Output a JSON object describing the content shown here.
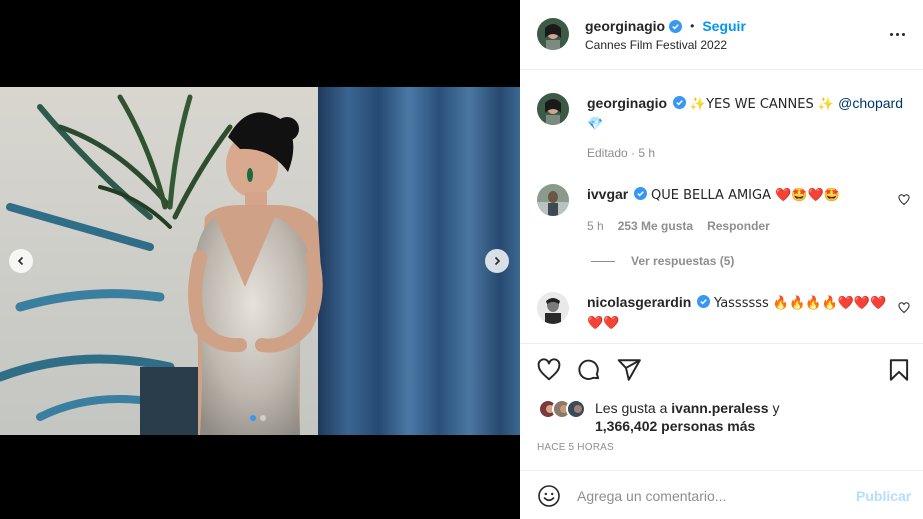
{
  "post": {
    "author": "georginagio",
    "follow_label": "Seguir",
    "bullet": "•",
    "location": "Cannes Film Festival 2022"
  },
  "caption": {
    "username": "georginagio",
    "text": "✨YES WE CANNES ✨ ",
    "mention": "@chopard",
    "emoji": "💎",
    "edited": "Editado · 5 h"
  },
  "comments": [
    {
      "username": "ivvgar",
      "text": "QUE BELLA AMIGA ❤️🤩❤️🤩",
      "time": "5 h",
      "likes": "253 Me gusta",
      "reply_label": "Responder",
      "view_replies": "Ver respuestas (5)"
    },
    {
      "username": "nicolasgerardin",
      "text": "Yassssss 🔥🔥🔥🔥❤️❤️❤️ ❤️❤️"
    }
  ],
  "likes": {
    "prefix": "Les gusta a ",
    "user": "ivann.peraless",
    "middle": " y",
    "count": "1,366,402 personas más"
  },
  "timestamp": "HACE 5 HORAS",
  "add_comment": {
    "placeholder": "Agrega un comentario...",
    "publish_label": "Publicar"
  },
  "carousel": {
    "slides": 2,
    "active": 1
  },
  "colors": {
    "accent": "#0095f6",
    "verified": "#3897f0",
    "publish_disabled": "#b2dffc",
    "muted": "#8e8e8e"
  },
  "icons": [
    "chevron-left-icon",
    "chevron-right-icon",
    "more-icon",
    "verified-icon",
    "heart-icon",
    "comment-icon",
    "share-icon",
    "save-icon",
    "emoji-icon"
  ]
}
